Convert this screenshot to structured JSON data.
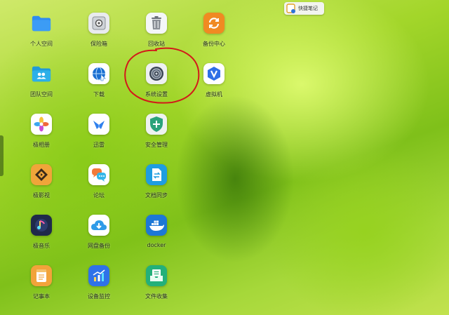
{
  "widget": {
    "label": "快捷笔记",
    "icon": "quick-note-icon"
  },
  "apps": [
    {
      "label": "个人空间",
      "icon": "folder-icon"
    },
    {
      "label": "保险箱",
      "icon": "safe-icon"
    },
    {
      "label": "回收站",
      "icon": "trash-icon"
    },
    {
      "label": "备份中心",
      "icon": "sync-icon"
    },
    {
      "label": "团队空间",
      "icon": "team-folder-icon"
    },
    {
      "label": "下载",
      "icon": "globe-download-icon"
    },
    {
      "label": "系统设置",
      "icon": "settings-icon"
    },
    {
      "label": "虚拟机",
      "icon": "virtual-machine-icon"
    },
    {
      "label": "极相册",
      "icon": "photos-icon"
    },
    {
      "label": "迅雷",
      "icon": "thunder-icon"
    },
    {
      "label": "安全管理",
      "icon": "shield-plus-icon"
    },
    {
      "label": "极影视",
      "icon": "video-icon"
    },
    {
      "label": "论坛",
      "icon": "chat-bubble-icon"
    },
    {
      "label": "文档同步",
      "icon": "doc-sync-icon"
    },
    {
      "label": "极音乐",
      "icon": "music-note-icon"
    },
    {
      "label": "网盘备份",
      "icon": "cloud-backup-icon"
    },
    {
      "label": "docker",
      "icon": "docker-whale-icon"
    },
    {
      "label": "记事本",
      "icon": "notepad-icon"
    },
    {
      "label": "设备监控",
      "icon": "monitor-chart-icon"
    },
    {
      "label": "文件收集",
      "icon": "file-collect-icon"
    }
  ],
  "colors": {
    "folder": "#2d8cf0",
    "sync": "#f08a22",
    "vm": "#2f6fe6",
    "shield": "#2aa37a",
    "docker": "#1d78d6",
    "annotation": "#d21a1a"
  }
}
